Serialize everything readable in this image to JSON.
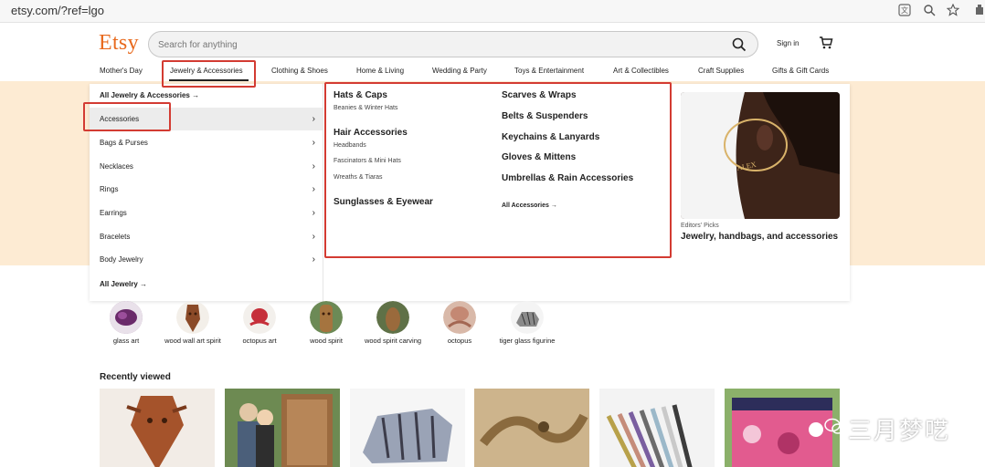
{
  "browser": {
    "url": "etsy.com/?ref=lgo"
  },
  "header": {
    "logo": "Etsy",
    "search_placeholder": "Search for anything",
    "sign_in": "Sign in"
  },
  "categories": [
    "Mother's Day",
    "Jewelry & Accessories",
    "Clothing & Shoes",
    "Home & Living",
    "Wedding & Party",
    "Toys & Entertainment",
    "Art & Collectibles",
    "Craft Supplies",
    "Gifts & Gift Cards"
  ],
  "menu": {
    "all_link": "All Jewelry & Accessories →",
    "left_items": [
      "Accessories",
      "Bags & Purses",
      "Necklaces",
      "Rings",
      "Earrings",
      "Bracelets",
      "Body Jewelry"
    ],
    "all_jewelry": "All Jewelry →",
    "col1": {
      "hats_caps": "Hats & Caps",
      "beanies": "Beanies & Winter Hats",
      "hair_accessories": "Hair Accessories",
      "headbands": "Headbands",
      "fascinators": "Fascinators & Mini Hats",
      "wreaths": "Wreaths & Tiaras",
      "sunglasses": "Sunglasses & Eyewear"
    },
    "col2": {
      "scarves": "Scarves & Wraps",
      "belts": "Belts & Suspenders",
      "keychains": "Keychains & Lanyards",
      "gloves": "Gloves & Mittens",
      "umbrellas": "Umbrellas & Rain Accessories",
      "all_accessories": "All Accessories →"
    },
    "promo": {
      "caption": "Editors' Picks",
      "title": "Jewelry, handbags, and accessories"
    }
  },
  "circles": [
    "glass art",
    "wood wall art spirit",
    "octopus art",
    "wood spirit",
    "wood spirit carving",
    "octopus",
    "tiger glass figurine"
  ],
  "recently_viewed": "Recently viewed",
  "watermark": "三月梦呓",
  "colors": {
    "brand": "#e8691d",
    "highlight": "#d33b32",
    "hero": "#fdebd3"
  }
}
